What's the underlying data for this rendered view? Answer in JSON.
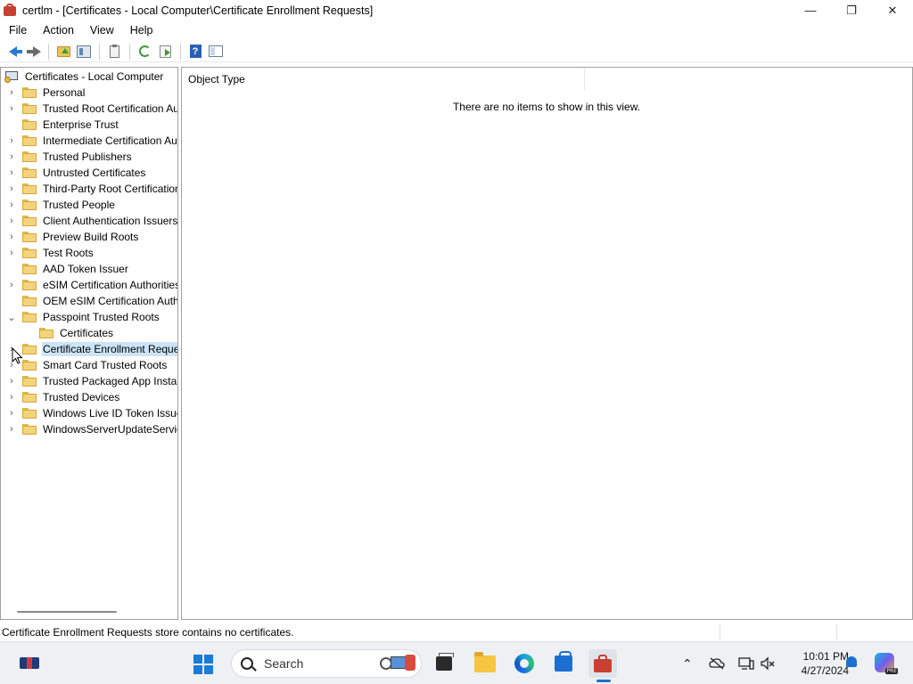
{
  "window": {
    "title": "certlm - [Certificates - Local Computer\\Certificate Enrollment Requests]",
    "minimize": "—",
    "restore": "❐",
    "close": "✕"
  },
  "menu": [
    "File",
    "Action",
    "View",
    "Help"
  ],
  "toolbar": {
    "buttons": [
      "back",
      "forward",
      "up-one-level",
      "show-hide-console-tree",
      "properties",
      "refresh",
      "export-list",
      "help",
      "show-hide-action-pane"
    ],
    "help_glyph": "?"
  },
  "tree": {
    "root": "Certificates - Local Computer",
    "items": [
      {
        "label": "Personal",
        "expandable": true
      },
      {
        "label": "Trusted Root Certification Au",
        "expandable": true
      },
      {
        "label": "Enterprise Trust",
        "expandable": false
      },
      {
        "label": "Intermediate Certification Au",
        "expandable": true
      },
      {
        "label": "Trusted Publishers",
        "expandable": true
      },
      {
        "label": "Untrusted Certificates",
        "expandable": true
      },
      {
        "label": "Third-Party Root Certification",
        "expandable": true
      },
      {
        "label": "Trusted People",
        "expandable": true
      },
      {
        "label": "Client Authentication Issuers",
        "expandable": true
      },
      {
        "label": "Preview Build Roots",
        "expandable": true
      },
      {
        "label": "Test Roots",
        "expandable": true
      },
      {
        "label": "AAD Token Issuer",
        "expandable": false
      },
      {
        "label": "eSIM Certification Authorities",
        "expandable": true
      },
      {
        "label": "OEM eSIM Certification Auth",
        "expandable": false
      },
      {
        "label": "Passpoint Trusted Roots",
        "expandable": true,
        "expanded": true
      },
      {
        "label": "Certificates",
        "expandable": false,
        "child": true
      },
      {
        "label": "Certificate Enrollment Reques",
        "expandable": true,
        "selected": true
      },
      {
        "label": "Smart Card Trusted Roots",
        "expandable": true
      },
      {
        "label": "Trusted Packaged App Install",
        "expandable": true
      },
      {
        "label": "Trusted Devices",
        "expandable": true
      },
      {
        "label": "Windows Live ID Token Issuer",
        "expandable": true
      },
      {
        "label": "WindowsServerUpdateService",
        "expandable": true
      }
    ],
    "chevron_collapsed": "›",
    "chevron_expanded": "⌄"
  },
  "content": {
    "column_header": "Object Type",
    "empty_message": "There are no items to show in this view."
  },
  "status": {
    "text": "Certificate Enrollment Requests store contains no certificates."
  },
  "taskbar": {
    "search_placeholder": "Search",
    "time": "10:01 PM",
    "date": "4/27/2024",
    "tray_chevron": "⌃",
    "copilot_badge": "PRE"
  }
}
